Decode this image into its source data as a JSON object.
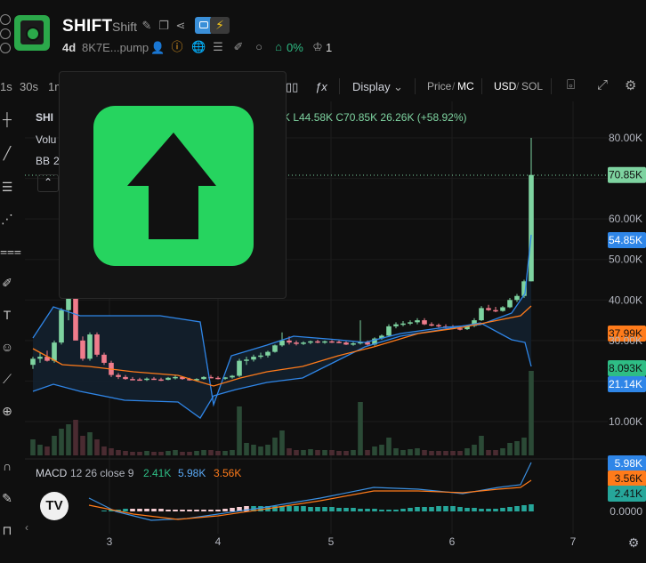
{
  "header": {
    "title": "SHIFT",
    "subtitle": "Shift",
    "age": "4d",
    "address": "8K7E...pump",
    "holders_pct": "0%",
    "count": "1"
  },
  "toolbar": {
    "intervals": [
      "1s",
      "30s",
      "1m"
    ],
    "display_label": "Display",
    "price_label": "Price",
    "mc_label": "MC",
    "usd_label": "USD",
    "sol_label": "SOL"
  },
  "legend": {
    "symbol": "SHI",
    "ohlc_tail": "K  L44.58K  C70.85K  26.26K (+58.92%)",
    "volume": "Volu",
    "bb": "BB",
    "bb_value": "2",
    "macd_label": "MACD",
    "macd_params": "12 26 close 9",
    "macd_val1": "2.41K",
    "macd_val2": "5.98K",
    "macd_val3": "3.56K"
  },
  "colors": {
    "up": "#7ed3a0",
    "down": "#f07c8c",
    "bb_band": "#2962ff",
    "basis": "#ff7b1a",
    "accent_green": "#2ebd85",
    "popup_green": "#26d45f"
  },
  "chart_data": {
    "type": "candlestick",
    "y_ticks": [
      "80.00K",
      "70.85K",
      "60.00K",
      "54.85K",
      "50.00K",
      "40.00K",
      "37.99K",
      "30.00K",
      "8.093K",
      "21.14K",
      "10.00K"
    ],
    "x_ticks": [
      "3",
      "4",
      "5",
      "6",
      "7"
    ],
    "macd_ticks": [
      "5.98K",
      "3.56K",
      "2.41K",
      "0.0000"
    ],
    "last_price": "70.85K",
    "bb_upper": "54.85K",
    "bb_basis": "37.99K",
    "bb_lower": "21.14K",
    "volume": "8.093K",
    "ylim": [
      0,
      85000
    ],
    "candles": [
      [
        24000,
        26000,
        23000,
        25500
      ],
      [
        25500,
        27000,
        24500,
        26000
      ],
      [
        26000,
        27500,
        24800,
        25000
      ],
      [
        25000,
        30000,
        24500,
        29500
      ],
      [
        29500,
        38000,
        29000,
        37500
      ],
      [
        37500,
        45000,
        35000,
        44000
      ],
      [
        44000,
        52000,
        42000,
        30000
      ],
      [
        30000,
        31000,
        25000,
        25500
      ],
      [
        25500,
        32000,
        25000,
        31500
      ],
      [
        31500,
        32000,
        26000,
        26500
      ],
      [
        26500,
        27000,
        24000,
        24500
      ],
      [
        24500,
        25000,
        21000,
        21500
      ],
      [
        21500,
        22000,
        20500,
        21000
      ],
      [
        21000,
        21500,
        20300,
        20500
      ],
      [
        20500,
        21000,
        20200,
        20400
      ],
      [
        20400,
        20800,
        20100,
        20300
      ],
      [
        20300,
        20900,
        20000,
        20600
      ],
      [
        20600,
        21000,
        20300,
        20400
      ],
      [
        20400,
        20800,
        20000,
        20300
      ],
      [
        20300,
        21000,
        20200,
        20800
      ],
      [
        20800,
        21500,
        20400,
        21000
      ],
      [
        21000,
        21200,
        20300,
        20500
      ],
      [
        20500,
        20800,
        20100,
        20300
      ],
      [
        20300,
        20700,
        20000,
        20500
      ],
      [
        20500,
        21200,
        20300,
        21000
      ],
      [
        21000,
        21500,
        20700,
        20800
      ],
      [
        20800,
        21200,
        20400,
        20600
      ],
      [
        20600,
        21000,
        20300,
        20900
      ],
      [
        20900,
        21500,
        20600,
        21300
      ],
      [
        21300,
        25500,
        21000,
        25000
      ],
      [
        25000,
        26000,
        24000,
        25300
      ],
      [
        25300,
        26500,
        24800,
        26000
      ],
      [
        26000,
        27000,
        25500,
        26300
      ],
      [
        26300,
        27500,
        25800,
        27200
      ],
      [
        27200,
        29000,
        27000,
        28800
      ],
      [
        28800,
        32000,
        28500,
        30000
      ],
      [
        30000,
        31000,
        29000,
        29500
      ],
      [
        29500,
        30000,
        28800,
        29200
      ],
      [
        29200,
        29800,
        28900,
        29500
      ],
      [
        29500,
        30000,
        29100,
        29800
      ],
      [
        29800,
        30200,
        29300,
        29600
      ],
      [
        29600,
        30000,
        29200,
        29800
      ],
      [
        29800,
        30100,
        29400,
        29700
      ],
      [
        29700,
        30000,
        29300,
        29500
      ],
      [
        29500,
        29800,
        28900,
        29000
      ],
      [
        29000,
        29600,
        28700,
        29300
      ],
      [
        29300,
        35000,
        29000,
        29600
      ],
      [
        29600,
        30000,
        28800,
        29000
      ],
      [
        29000,
        30800,
        28700,
        30500
      ],
      [
        30500,
        31500,
        30200,
        31200
      ],
      [
        31200,
        34000,
        31000,
        33500
      ],
      [
        33500,
        34500,
        33000,
        34000
      ],
      [
        34000,
        34800,
        33500,
        34200
      ],
      [
        34200,
        35000,
        33800,
        34500
      ],
      [
        34500,
        35500,
        34000,
        35000
      ],
      [
        35000,
        35500,
        33800,
        34000
      ],
      [
        34000,
        34500,
        33500,
        33800
      ],
      [
        33800,
        34200,
        33200,
        33500
      ],
      [
        33500,
        34000,
        33000,
        33300
      ],
      [
        33300,
        33800,
        32800,
        33000
      ],
      [
        33000,
        33500,
        32500,
        32800
      ],
      [
        32800,
        33800,
        32600,
        33600
      ],
      [
        33600,
        35500,
        33300,
        35000
      ],
      [
        35000,
        38500,
        34800,
        38000
      ],
      [
        38000,
        38800,
        37300,
        37500
      ],
      [
        37500,
        38300,
        37000,
        37300
      ],
      [
        37300,
        38500,
        37100,
        38200
      ],
      [
        38200,
        40500,
        38000,
        40000
      ],
      [
        40000,
        41500,
        39500,
        41000
      ],
      [
        41000,
        45000,
        40500,
        44600
      ],
      [
        44600,
        80000,
        44580,
        70850
      ]
    ]
  }
}
